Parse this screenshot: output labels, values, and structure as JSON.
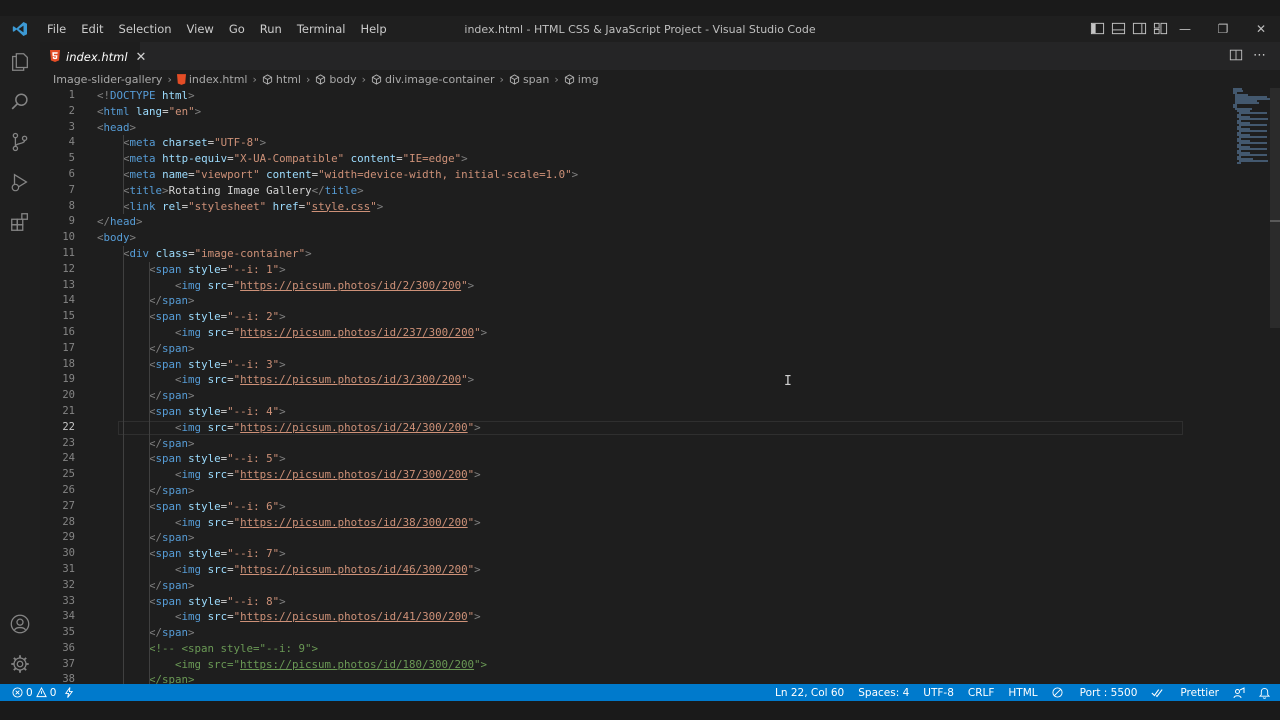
{
  "menu": [
    "File",
    "Edit",
    "Selection",
    "View",
    "Go",
    "Run",
    "Terminal",
    "Help"
  ],
  "window_title": "index.html - HTML CSS & JavaScript Project - Visual Studio Code",
  "tab": {
    "label": "index.html"
  },
  "breadcrumb": [
    "Image-slider-gallery",
    "index.html",
    "html",
    "body",
    "div.image-container",
    "span",
    "img"
  ],
  "editor": {
    "active_line": 22,
    "lines": [
      [
        [
          "tag",
          "<!"
        ],
        [
          "name",
          "DOCTYPE"
        ],
        [
          "txt",
          " "
        ],
        [
          "attr",
          "html"
        ],
        [
          "tag",
          ">"
        ]
      ],
      [
        [
          "tag",
          "<"
        ],
        [
          "name",
          "html"
        ],
        [
          "txt",
          " "
        ],
        [
          "attr",
          "lang"
        ],
        [
          "txt",
          "="
        ],
        [
          "str",
          "\"en\""
        ],
        [
          "tag",
          ">"
        ]
      ],
      [
        [
          "tag",
          "<"
        ],
        [
          "name",
          "head"
        ],
        [
          "tag",
          ">"
        ]
      ],
      [
        [
          "txt",
          "    "
        ],
        [
          "tag",
          "<"
        ],
        [
          "name",
          "meta"
        ],
        [
          "txt",
          " "
        ],
        [
          "attr",
          "charset"
        ],
        [
          "txt",
          "="
        ],
        [
          "str",
          "\"UTF-8\""
        ],
        [
          "tag",
          ">"
        ]
      ],
      [
        [
          "txt",
          "    "
        ],
        [
          "tag",
          "<"
        ],
        [
          "name",
          "meta"
        ],
        [
          "txt",
          " "
        ],
        [
          "attr",
          "http-equiv"
        ],
        [
          "txt",
          "="
        ],
        [
          "str",
          "\"X-UA-Compatible\""
        ],
        [
          "txt",
          " "
        ],
        [
          "attr",
          "content"
        ],
        [
          "txt",
          "="
        ],
        [
          "str",
          "\"IE=edge\""
        ],
        [
          "tag",
          ">"
        ]
      ],
      [
        [
          "txt",
          "    "
        ],
        [
          "tag",
          "<"
        ],
        [
          "name",
          "meta"
        ],
        [
          "txt",
          " "
        ],
        [
          "attr",
          "name"
        ],
        [
          "txt",
          "="
        ],
        [
          "str",
          "\"viewport\""
        ],
        [
          "txt",
          " "
        ],
        [
          "attr",
          "content"
        ],
        [
          "txt",
          "="
        ],
        [
          "str",
          "\"width=device-width, initial-scale=1.0\""
        ],
        [
          "tag",
          ">"
        ]
      ],
      [
        [
          "txt",
          "    "
        ],
        [
          "tag",
          "<"
        ],
        [
          "name",
          "title"
        ],
        [
          "tag",
          ">"
        ],
        [
          "txt",
          "Rotating Image Gallery"
        ],
        [
          "tag",
          "</"
        ],
        [
          "name",
          "title"
        ],
        [
          "tag",
          ">"
        ]
      ],
      [
        [
          "txt",
          "    "
        ],
        [
          "tag",
          "<"
        ],
        [
          "name",
          "link"
        ],
        [
          "txt",
          " "
        ],
        [
          "attr",
          "rel"
        ],
        [
          "txt",
          "="
        ],
        [
          "str",
          "\"stylesheet\""
        ],
        [
          "txt",
          " "
        ],
        [
          "attr",
          "href"
        ],
        [
          "txt",
          "="
        ],
        [
          "str",
          "\""
        ],
        [
          "url",
          "style.css"
        ],
        [
          "str",
          "\""
        ],
        [
          "tag",
          ">"
        ]
      ],
      [
        [
          "tag",
          "</"
        ],
        [
          "name",
          "head"
        ],
        [
          "tag",
          ">"
        ]
      ],
      [
        [
          "tag",
          "<"
        ],
        [
          "name",
          "body"
        ],
        [
          "tag",
          ">"
        ]
      ],
      [
        [
          "txt",
          "    "
        ],
        [
          "tag",
          "<"
        ],
        [
          "name",
          "div"
        ],
        [
          "txt",
          " "
        ],
        [
          "attr",
          "class"
        ],
        [
          "txt",
          "="
        ],
        [
          "str",
          "\"image-container\""
        ],
        [
          "tag",
          ">"
        ]
      ],
      [
        [
          "txt",
          "        "
        ],
        [
          "tag",
          "<"
        ],
        [
          "name",
          "span"
        ],
        [
          "txt",
          " "
        ],
        [
          "attr",
          "style"
        ],
        [
          "txt",
          "="
        ],
        [
          "str",
          "\"--i: 1\""
        ],
        [
          "tag",
          ">"
        ]
      ],
      [
        [
          "txt",
          "            "
        ],
        [
          "tag",
          "<"
        ],
        [
          "name",
          "img"
        ],
        [
          "txt",
          " "
        ],
        [
          "attr",
          "src"
        ],
        [
          "txt",
          "="
        ],
        [
          "str",
          "\""
        ],
        [
          "url",
          "https://picsum.photos/id/2/300/200"
        ],
        [
          "str",
          "\""
        ],
        [
          "tag",
          ">"
        ]
      ],
      [
        [
          "txt",
          "        "
        ],
        [
          "tag",
          "</"
        ],
        [
          "name",
          "span"
        ],
        [
          "tag",
          ">"
        ]
      ],
      [
        [
          "txt",
          "        "
        ],
        [
          "tag",
          "<"
        ],
        [
          "name",
          "span"
        ],
        [
          "txt",
          " "
        ],
        [
          "attr",
          "style"
        ],
        [
          "txt",
          "="
        ],
        [
          "str",
          "\"--i: 2\""
        ],
        [
          "tag",
          ">"
        ]
      ],
      [
        [
          "txt",
          "            "
        ],
        [
          "tag",
          "<"
        ],
        [
          "name",
          "img"
        ],
        [
          "txt",
          " "
        ],
        [
          "attr",
          "src"
        ],
        [
          "txt",
          "="
        ],
        [
          "str",
          "\""
        ],
        [
          "url",
          "https://picsum.photos/id/237/300/200"
        ],
        [
          "str",
          "\""
        ],
        [
          "tag",
          ">"
        ]
      ],
      [
        [
          "txt",
          "        "
        ],
        [
          "tag",
          "</"
        ],
        [
          "name",
          "span"
        ],
        [
          "tag",
          ">"
        ]
      ],
      [
        [
          "txt",
          "        "
        ],
        [
          "tag",
          "<"
        ],
        [
          "name",
          "span"
        ],
        [
          "txt",
          " "
        ],
        [
          "attr",
          "style"
        ],
        [
          "txt",
          "="
        ],
        [
          "str",
          "\"--i: 3\""
        ],
        [
          "tag",
          ">"
        ]
      ],
      [
        [
          "txt",
          "            "
        ],
        [
          "tag",
          "<"
        ],
        [
          "name",
          "img"
        ],
        [
          "txt",
          " "
        ],
        [
          "attr",
          "src"
        ],
        [
          "txt",
          "="
        ],
        [
          "str",
          "\""
        ],
        [
          "url",
          "https://picsum.photos/id/3/300/200"
        ],
        [
          "str",
          "\""
        ],
        [
          "tag",
          ">"
        ]
      ],
      [
        [
          "txt",
          "        "
        ],
        [
          "tag",
          "</"
        ],
        [
          "name",
          "span"
        ],
        [
          "tag",
          ">"
        ]
      ],
      [
        [
          "txt",
          "        "
        ],
        [
          "tag",
          "<"
        ],
        [
          "name",
          "span"
        ],
        [
          "txt",
          " "
        ],
        [
          "attr",
          "style"
        ],
        [
          "txt",
          "="
        ],
        [
          "str",
          "\"--i: 4\""
        ],
        [
          "tag",
          ">"
        ]
      ],
      [
        [
          "txt",
          "            "
        ],
        [
          "tag",
          "<"
        ],
        [
          "name",
          "img"
        ],
        [
          "txt",
          " "
        ],
        [
          "attr",
          "src"
        ],
        [
          "txt",
          "="
        ],
        [
          "str",
          "\""
        ],
        [
          "url",
          "https://picsum.photos/id/24/300/200"
        ],
        [
          "str",
          "\""
        ],
        [
          "tag",
          ">"
        ]
      ],
      [
        [
          "txt",
          "        "
        ],
        [
          "tag",
          "</"
        ],
        [
          "name",
          "span"
        ],
        [
          "tag",
          ">"
        ]
      ],
      [
        [
          "txt",
          "        "
        ],
        [
          "tag",
          "<"
        ],
        [
          "name",
          "span"
        ],
        [
          "txt",
          " "
        ],
        [
          "attr",
          "style"
        ],
        [
          "txt",
          "="
        ],
        [
          "str",
          "\"--i: 5\""
        ],
        [
          "tag",
          ">"
        ]
      ],
      [
        [
          "txt",
          "            "
        ],
        [
          "tag",
          "<"
        ],
        [
          "name",
          "img"
        ],
        [
          "txt",
          " "
        ],
        [
          "attr",
          "src"
        ],
        [
          "txt",
          "="
        ],
        [
          "str",
          "\""
        ],
        [
          "url",
          "https://picsum.photos/id/37/300/200"
        ],
        [
          "str",
          "\""
        ],
        [
          "tag",
          ">"
        ]
      ],
      [
        [
          "txt",
          "        "
        ],
        [
          "tag",
          "</"
        ],
        [
          "name",
          "span"
        ],
        [
          "tag",
          ">"
        ]
      ],
      [
        [
          "txt",
          "        "
        ],
        [
          "tag",
          "<"
        ],
        [
          "name",
          "span"
        ],
        [
          "txt",
          " "
        ],
        [
          "attr",
          "style"
        ],
        [
          "txt",
          "="
        ],
        [
          "str",
          "\"--i: 6\""
        ],
        [
          "tag",
          ">"
        ]
      ],
      [
        [
          "txt",
          "            "
        ],
        [
          "tag",
          "<"
        ],
        [
          "name",
          "img"
        ],
        [
          "txt",
          " "
        ],
        [
          "attr",
          "src"
        ],
        [
          "txt",
          "="
        ],
        [
          "str",
          "\""
        ],
        [
          "url",
          "https://picsum.photos/id/38/300/200"
        ],
        [
          "str",
          "\""
        ],
        [
          "tag",
          ">"
        ]
      ],
      [
        [
          "txt",
          "        "
        ],
        [
          "tag",
          "</"
        ],
        [
          "name",
          "span"
        ],
        [
          "tag",
          ">"
        ]
      ],
      [
        [
          "txt",
          "        "
        ],
        [
          "tag",
          "<"
        ],
        [
          "name",
          "span"
        ],
        [
          "txt",
          " "
        ],
        [
          "attr",
          "style"
        ],
        [
          "txt",
          "="
        ],
        [
          "str",
          "\"--i: 7\""
        ],
        [
          "tag",
          ">"
        ]
      ],
      [
        [
          "txt",
          "            "
        ],
        [
          "tag",
          "<"
        ],
        [
          "name",
          "img"
        ],
        [
          "txt",
          " "
        ],
        [
          "attr",
          "src"
        ],
        [
          "txt",
          "="
        ],
        [
          "str",
          "\""
        ],
        [
          "url",
          "https://picsum.photos/id/46/300/200"
        ],
        [
          "str",
          "\""
        ],
        [
          "tag",
          ">"
        ]
      ],
      [
        [
          "txt",
          "        "
        ],
        [
          "tag",
          "</"
        ],
        [
          "name",
          "span"
        ],
        [
          "tag",
          ">"
        ]
      ],
      [
        [
          "txt",
          "        "
        ],
        [
          "tag",
          "<"
        ],
        [
          "name",
          "span"
        ],
        [
          "txt",
          " "
        ],
        [
          "attr",
          "style"
        ],
        [
          "txt",
          "="
        ],
        [
          "str",
          "\"--i: 8\""
        ],
        [
          "tag",
          ">"
        ]
      ],
      [
        [
          "txt",
          "            "
        ],
        [
          "tag",
          "<"
        ],
        [
          "name",
          "img"
        ],
        [
          "txt",
          " "
        ],
        [
          "attr",
          "src"
        ],
        [
          "txt",
          "="
        ],
        [
          "str",
          "\""
        ],
        [
          "url",
          "https://picsum.photos/id/41/300/200"
        ],
        [
          "str",
          "\""
        ],
        [
          "tag",
          ">"
        ]
      ],
      [
        [
          "txt",
          "        "
        ],
        [
          "tag",
          "</"
        ],
        [
          "name",
          "span"
        ],
        [
          "tag",
          ">"
        ]
      ],
      [
        [
          "txt",
          "        "
        ],
        [
          "cmt",
          "<!-- <span style=\"--i: 9\">"
        ]
      ],
      [
        [
          "txt",
          "            "
        ],
        [
          "cmt",
          "<img src=\""
        ],
        [
          "cmturl",
          "https://picsum.photos/id/180/300/200"
        ],
        [
          "cmt",
          "\">"
        ]
      ],
      [
        [
          "txt",
          "        "
        ],
        [
          "cmt",
          "</span>"
        ]
      ]
    ]
  },
  "status": {
    "errors": "0",
    "warnings": "0",
    "position": "Ln 22, Col 60",
    "spaces": "Spaces: 4",
    "encoding": "UTF-8",
    "eol": "CRLF",
    "language": "HTML",
    "port": "Port : 5500",
    "formatter": "Prettier"
  },
  "colors": {
    "statusbar": "#007acc",
    "accent": "#0078d4"
  }
}
